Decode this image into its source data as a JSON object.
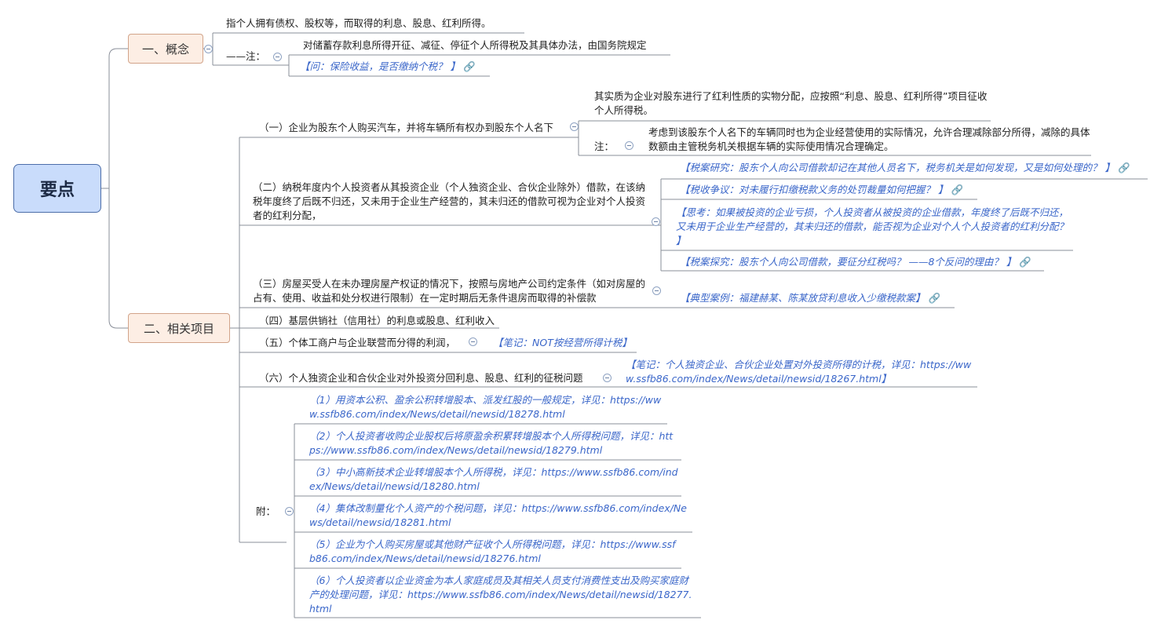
{
  "root": {
    "label": "要点"
  },
  "concept": {
    "label": "一、概念",
    "definition": "指个人拥有债权、股权等，而取得的利息、股息、红利所得。",
    "note_label": "——注：",
    "note_text": "对储蓄存款利息所得开征、减征、停征个人所得税及其具体办法，由国务院规定",
    "note_link": "【问：保险收益，是否缴纳个税？ 】"
  },
  "items": {
    "label": "二、相关项目",
    "item1": {
      "text": "（一）企业为股东个人购买汽车，并将车辆所有权办到股东个人名下",
      "detail": "其实质为企业对股东进行了红利性质的实物分配，应按照“利息、股息、红利所得”项目征收个人所得税。",
      "note_label": "注：",
      "note_text": "考虑到该股东个人名下的车辆同时也为企业经营使用的实际情况，允许合理减除部分所得，减除的具体数额由主管税务机关根据车辆的实际使用情况合理确定。"
    },
    "item2": {
      "text": "（二）纳税年度内个人投资者从其投资企业（个人独资企业、合伙企业除外）借款，在该纳税年度终了后既不归还，又未用于企业生产经营的，其未归还的借款可视为企业对个人投资者的红利分配，",
      "notes": [
        "【税案研究：股东个人向公司借款却记在其他人员名下，税务机关是如何发现，又是如何处理的？ 】",
        "【税收争议：对未履行扣缴税款义务的处罚裁量如何把握？ 】",
        "【思考：如果被投资的企业亏损，个人投资者从被投资的企业借款，年度终了后既不归还，又未用于企业生产经营的，其未归还的借款，能否视为企业对个人个人投资者的红利分配？ 】",
        "【税案探究：股东个人向公司借款，要征分红税吗？ ——8个反问的理由？ 】"
      ]
    },
    "item3": {
      "text": "（三）房屋买受人在未办理房屋产权证的情况下，按照与房地产公司约定条件（如对房屋的占有、使用、收益和处分权进行限制）在一定时期后无条件退房而取得的补偿款",
      "note": "【典型案例：福建赫某、陈某放贷利息收入少缴税款案】"
    },
    "item4": {
      "text": "（四）基层供销社（信用社）的利息或股息、红利收入"
    },
    "item5": {
      "text": "（五）个体工商户与企业联营而分得的利润，",
      "note": "【笔记：NOT按经营所得计税】"
    },
    "item6": {
      "text": "（六）个人独资企业和合伙企业对外投资分回利息、股息、红利的征税问题",
      "note": "【笔记：个人独资企业、合伙企业处置对外投资所得的计税，详见：https://www.ssfb86.com/index/News/detail/newsid/18267.html】"
    },
    "appendix": {
      "label": "附：",
      "entries": [
        "（1）用资本公积、盈余公积转增股本、派发红股的一般规定，详见：https://www.ssfb86.com/index/News/detail/newsid/18278.html",
        "（2）个人投资者收购企业股权后将原盈余积累转增股本个人所得税问题，详见：https://www.ssfb86.com/index/News/detail/newsid/18279.html",
        "（3）中小高新技术企业转增股本个人所得税，详见：https://www.ssfb86.com/index/News/detail/newsid/18280.html",
        "（4）集体改制量化个人资产的个税问题，详见：https://www.ssfb86.com/index/News/detail/newsid/18281.html",
        "（5）企业为个人购买房屋或其他财产征收个人所得税问题，详见：https://www.ssfb86.com/index/News/detail/newsid/18276.html",
        "（6）个人投资者以企业资金为本人家庭成员及其相关人员支付消费性支出及购买家庭财产的处理问题，详见：https://www.ssfb86.com/index/News/detail/newsid/18277.html"
      ]
    }
  }
}
